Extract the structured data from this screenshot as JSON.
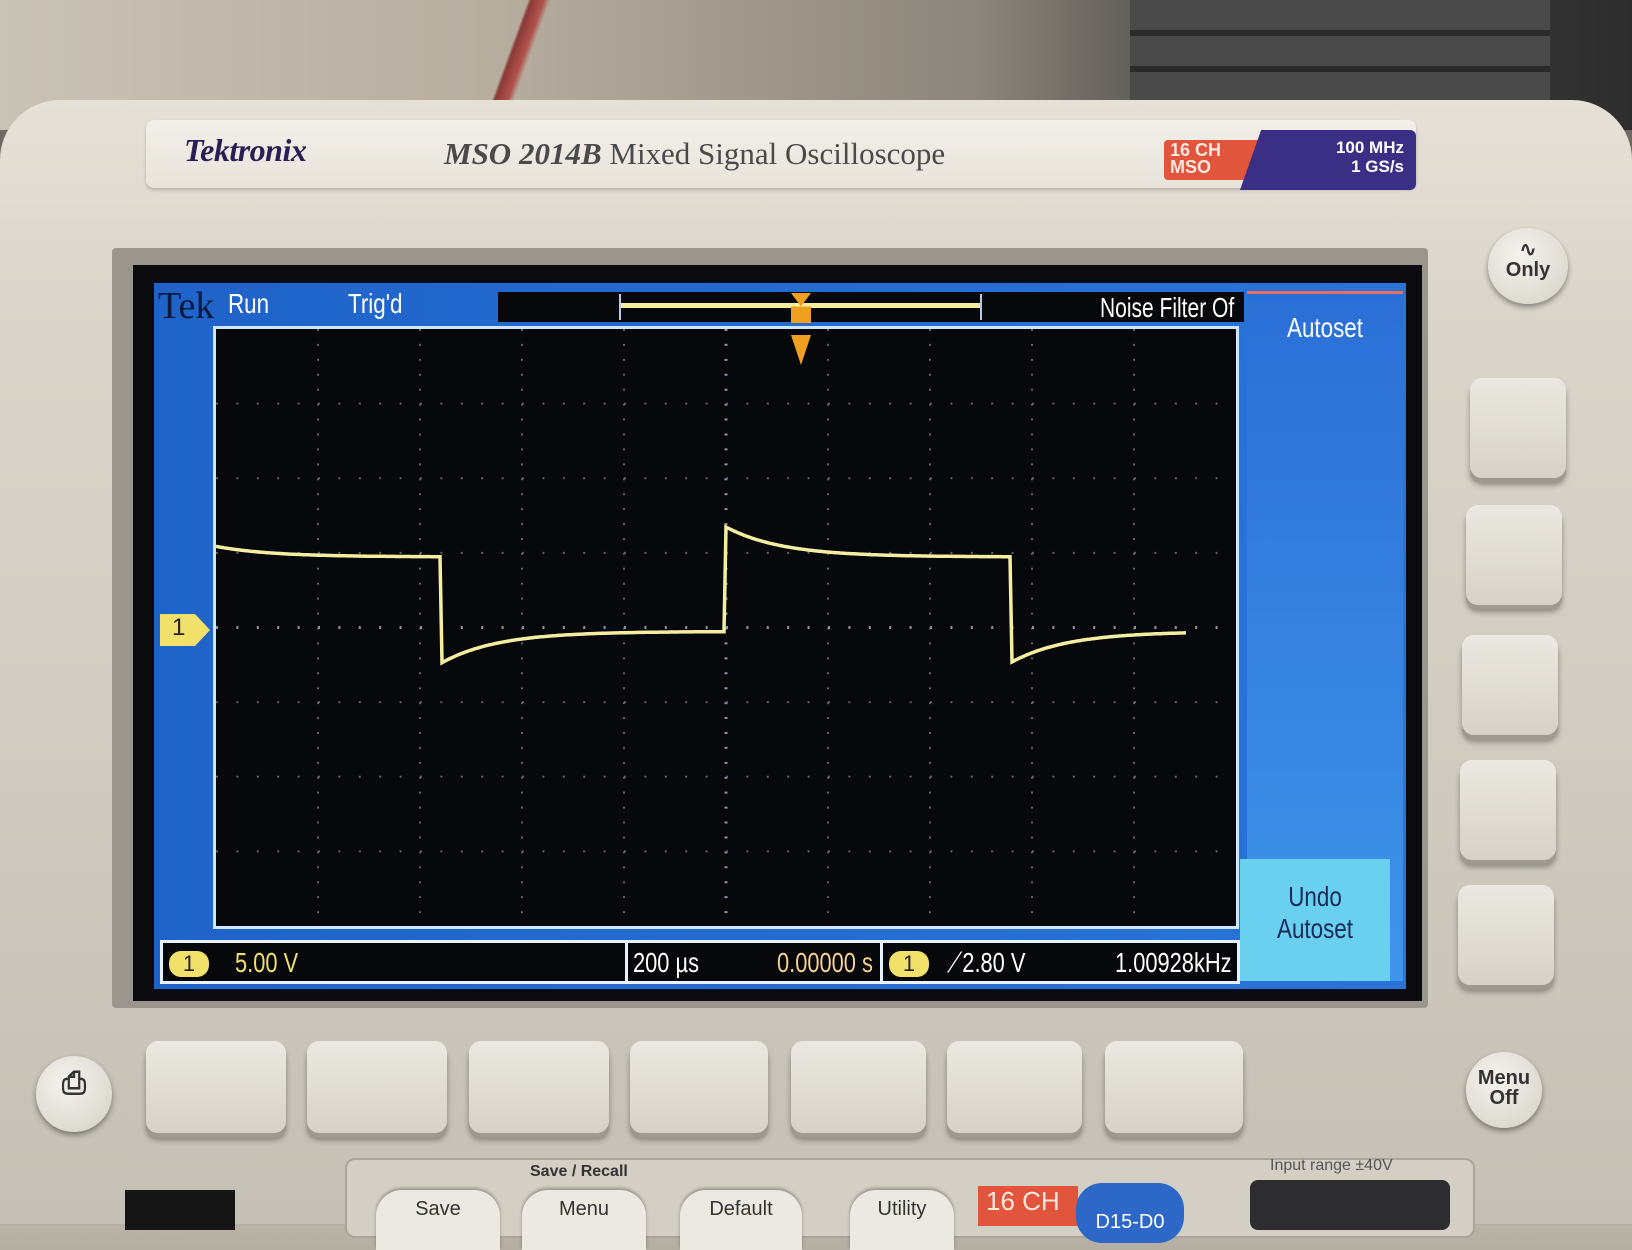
{
  "device": {
    "brand": "Tektronix",
    "model_number": "MSO 2014B",
    "model_desc": "Mixed Signal Oscilloscope",
    "badge_channels": [
      "16 CH",
      "MSO"
    ],
    "badge_specs": [
      "100 MHz",
      "1 GS/s"
    ]
  },
  "screen": {
    "top_bar": {
      "logo": "Tek",
      "run_state": "Run",
      "trigger_state": "Trig'd",
      "noise_filter": "Noise Filter Of"
    },
    "side_menu": {
      "autoset": "Autoset",
      "undo_line1": "Undo",
      "undo_line2": "Autoset"
    },
    "channel_marker": "1",
    "bottom_bar": {
      "ch_badge": "1",
      "volts_per_div": "5.00 V",
      "time_per_div": "200 µs",
      "trigger_position": "0.00000 s",
      "trigger_ch_badge": "1",
      "trigger_level": "2.80 V",
      "frequency": "1.00928kHz"
    },
    "colors": {
      "screen_blue": "#2a74d8",
      "trace": "#f3ef9e",
      "badge": "#f1e06a"
    }
  },
  "waveform": {
    "volts_per_div": 5,
    "us_per_div": 200,
    "high_v": 5,
    "low_v": 0,
    "overshoot_v": 2,
    "undershoot_v": -2.1,
    "tau_us": 110,
    "period_us": 1115,
    "rising_edge_us": 0,
    "falling_edge_us": -560
  },
  "front_panel": {
    "wave_only": "Only",
    "menu_off": [
      "Menu",
      "Off"
    ],
    "save_recall_label": "Save / Recall",
    "buttons": [
      "Save",
      "Menu",
      "Default",
      "Utility"
    ],
    "ch16_badge": "16 CH",
    "digital_button": "D15-D0",
    "input_range": "Input range ±40V"
  }
}
